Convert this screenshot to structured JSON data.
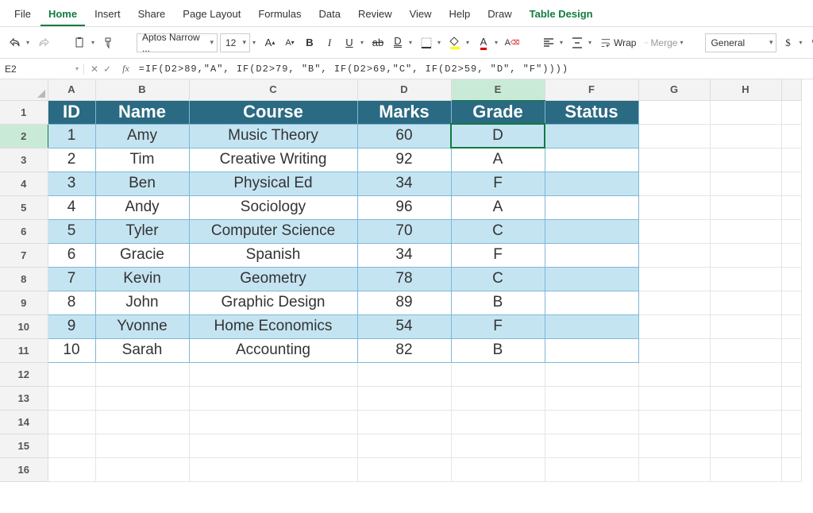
{
  "tabs": {
    "file": "File",
    "home": "Home",
    "insert": "Insert",
    "share": "Share",
    "page_layout": "Page Layout",
    "formulas": "Formulas",
    "data": "Data",
    "review": "Review",
    "view": "View",
    "help": "Help",
    "draw": "Draw",
    "table_design": "Table Design"
  },
  "toolbar": {
    "font_name": "Aptos Narrow ...",
    "font_size": "12",
    "wrap_label": "Wrap",
    "merge_label": "Merge",
    "number_format": "General"
  },
  "formula_bar": {
    "cell_ref": "E2",
    "formula": "=IF(D2>89,\"A\", IF(D2>79, \"B\", IF(D2>69,\"C\", IF(D2>59, \"D\", \"F\"))))"
  },
  "columns": [
    "A",
    "B",
    "C",
    "D",
    "E",
    "F",
    "G",
    "H",
    ""
  ],
  "selected_col_index": 4,
  "selected_row_index": 1,
  "row_numbers": [
    1,
    2,
    3,
    4,
    5,
    6,
    7,
    8,
    9,
    10,
    11,
    12,
    13,
    14,
    15,
    16
  ],
  "table": {
    "headers": {
      "id": "ID",
      "name": "Name",
      "course": "Course",
      "marks": "Marks",
      "grade": "Grade",
      "status": "Status"
    },
    "rows": [
      {
        "id": "1",
        "name": "Amy",
        "course": "Music Theory",
        "marks": "60",
        "grade": "D",
        "status": ""
      },
      {
        "id": "2",
        "name": "Tim",
        "course": "Creative Writing",
        "marks": "92",
        "grade": "A",
        "status": ""
      },
      {
        "id": "3",
        "name": "Ben",
        "course": "Physical Ed",
        "marks": "34",
        "grade": "F",
        "status": ""
      },
      {
        "id": "4",
        "name": "Andy",
        "course": "Sociology",
        "marks": "96",
        "grade": "A",
        "status": ""
      },
      {
        "id": "5",
        "name": "Tyler",
        "course": "Computer Science",
        "marks": "70",
        "grade": "C",
        "status": ""
      },
      {
        "id": "6",
        "name": "Gracie",
        "course": "Spanish",
        "marks": "34",
        "grade": "F",
        "status": ""
      },
      {
        "id": "7",
        "name": "Kevin",
        "course": "Geometry",
        "marks": "78",
        "grade": "C",
        "status": ""
      },
      {
        "id": "8",
        "name": "John",
        "course": "Graphic Design",
        "marks": "89",
        "grade": "B",
        "status": ""
      },
      {
        "id": "9",
        "name": "Yvonne",
        "course": "Home Economics",
        "marks": "54",
        "grade": "F",
        "status": ""
      },
      {
        "id": "10",
        "name": "Sarah",
        "course": "Accounting",
        "marks": "82",
        "grade": "B",
        "status": ""
      }
    ]
  }
}
